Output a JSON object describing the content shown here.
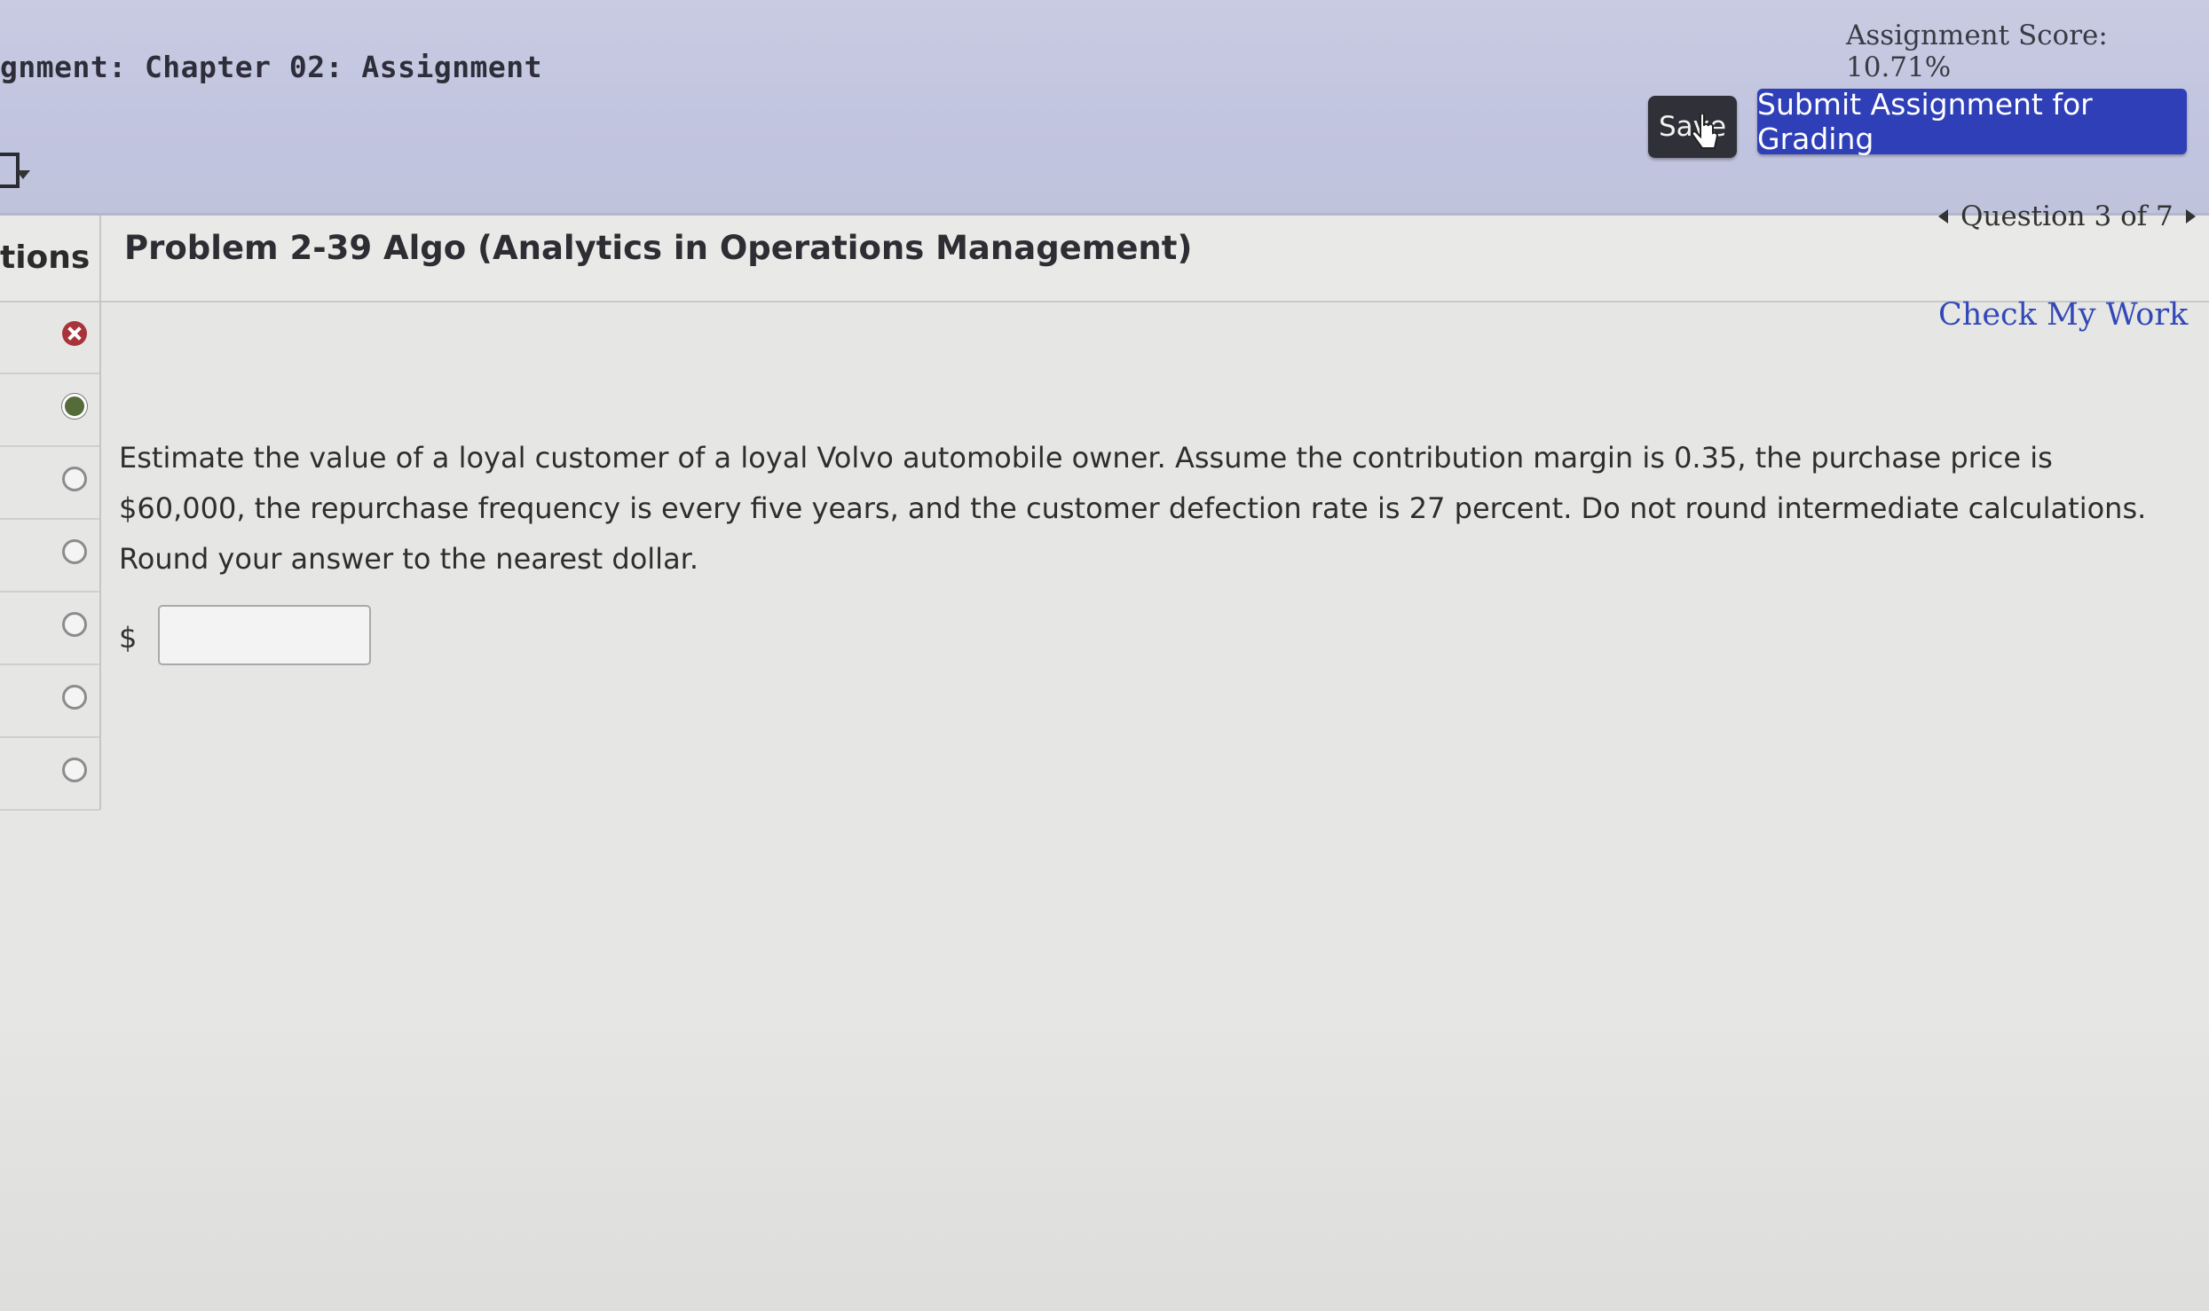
{
  "header": {
    "assignment_title": "gnment: Chapter 02: Assignment",
    "assignment_score": "Assignment Score: 10.71%",
    "save_label": "Save",
    "submit_label": "Submit Assignment for Grading"
  },
  "subheader": {
    "questions_tab_label": "tions",
    "problem_title": "Problem 2-39 Algo (Analytics in Operations Management)",
    "question_nav_label": "Question 3 of 7",
    "check_my_work_label": "Check My Work"
  },
  "question_list": [
    {
      "status": "incorrect"
    },
    {
      "status": "partial"
    },
    {
      "status": "unanswered"
    },
    {
      "status": "unanswered"
    },
    {
      "status": "unanswered"
    },
    {
      "status": "unanswered"
    },
    {
      "status": "unanswered"
    }
  ],
  "question": {
    "text": "Estimate the value of a loyal customer of a loyal Volvo automobile owner. Assume the contribution margin is 0.35, the purchase price is $60,000, the repurchase frequency is every five years, and the customer defection rate is 27 percent. Do not round intermediate calculations. Round your answer to the nearest dollar.",
    "currency_symbol": "$",
    "answer_value": ""
  },
  "colors": {
    "header_bg": "#c4c7df",
    "submit_button": "#2f3fb8",
    "save_button": "#2f3038",
    "link": "#3248b8",
    "incorrect_icon": "#a8343b"
  }
}
